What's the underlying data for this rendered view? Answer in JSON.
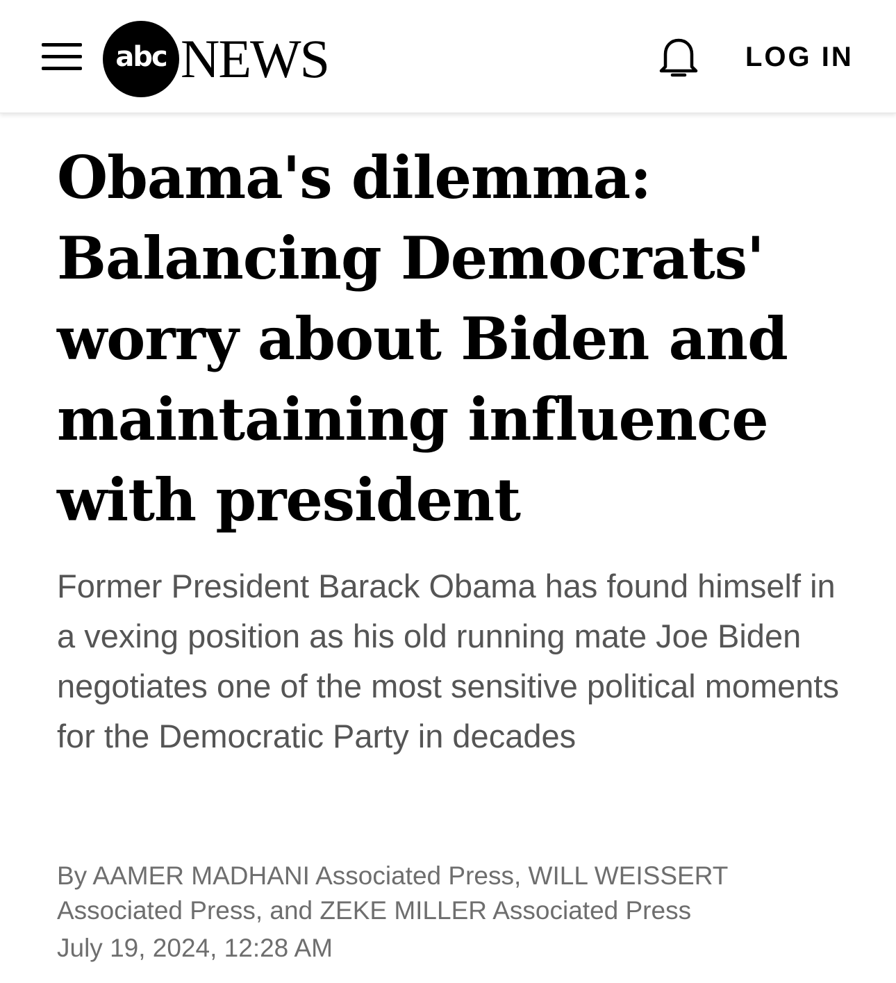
{
  "header": {
    "menu_icon": "hamburger-menu-icon",
    "logo_mark": "abc",
    "logo_wordmark": "NEWS",
    "notification_icon": "bell-icon",
    "login_label": "LOG IN"
  },
  "article": {
    "headline": "Obama's dilemma: Balancing Democrats' worry about Biden and maintaining influence with president",
    "dek": "Former President Barack Obama has found himself in a vexing position as his old running mate Joe Biden negotiates one of the most sensitive political moments for the Democratic Party in decades",
    "byline": "By AAMER MADHANI Associated Press, WILL WEISSERT Associated Press, and ZEKE MILLER Associated Press",
    "timestamp": "July 19, 2024, 12:28 AM"
  },
  "colors": {
    "background": "#ffffff",
    "headline_text": "#000000",
    "dek_text": "#555555",
    "meta_text": "#6e6e6e",
    "logo": "#000000"
  }
}
